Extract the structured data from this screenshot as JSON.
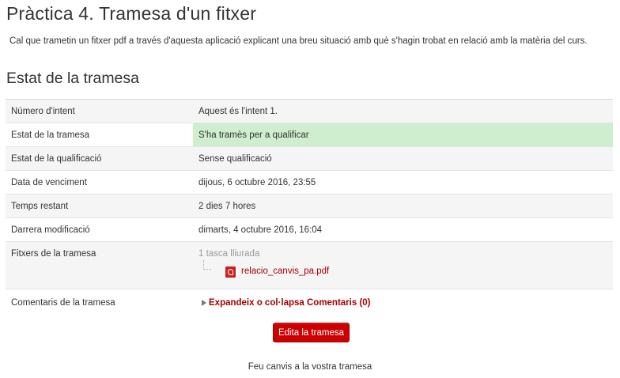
{
  "page": {
    "title": "Pràctica 4. Tramesa d'un fitxer",
    "intro": "Cal que trametin un fitxer pdf a través d'aquesta aplicació explicant una breu situació amb què s'hagin trobat en relació amb la matèria del curs."
  },
  "section": {
    "title": "Estat de la tramesa"
  },
  "status_rows": [
    {
      "label": "Número d'intent",
      "value": "Aquest és l'intent 1."
    },
    {
      "label": "Estat de la tramesa",
      "value": "S'ha tramès per a qualificar"
    },
    {
      "label": "Estat de la qualificació",
      "value": "Sense qualificació"
    },
    {
      "label": "Data de venciment",
      "value": "dijous, 6 octubre 2016, 23:55"
    },
    {
      "label": "Temps restant",
      "value": "2 dies 7 hores"
    },
    {
      "label": "Darrera modificació",
      "value": "dimarts, 4 octubre 2016, 16:04"
    },
    {
      "label": "Fitxers de la tramesa",
      "tasks": "1 tasca lliurada",
      "file": "relacio_canvis_pa.pdf"
    },
    {
      "label": "Comentaris de la tramesa",
      "toggle": "Expandeix o col·lapsa Comentaris (0)"
    }
  ],
  "actions": {
    "edit_label": "Edita la tramesa",
    "help_text": "Feu canvis a la vostra tramesa"
  },
  "colors": {
    "accent": "#cc0000",
    "link": "#a30000",
    "submitted_bg": "#cfedcf"
  },
  "icons": {
    "file": "pdf-icon",
    "toggle": "expand-triangle-icon"
  }
}
